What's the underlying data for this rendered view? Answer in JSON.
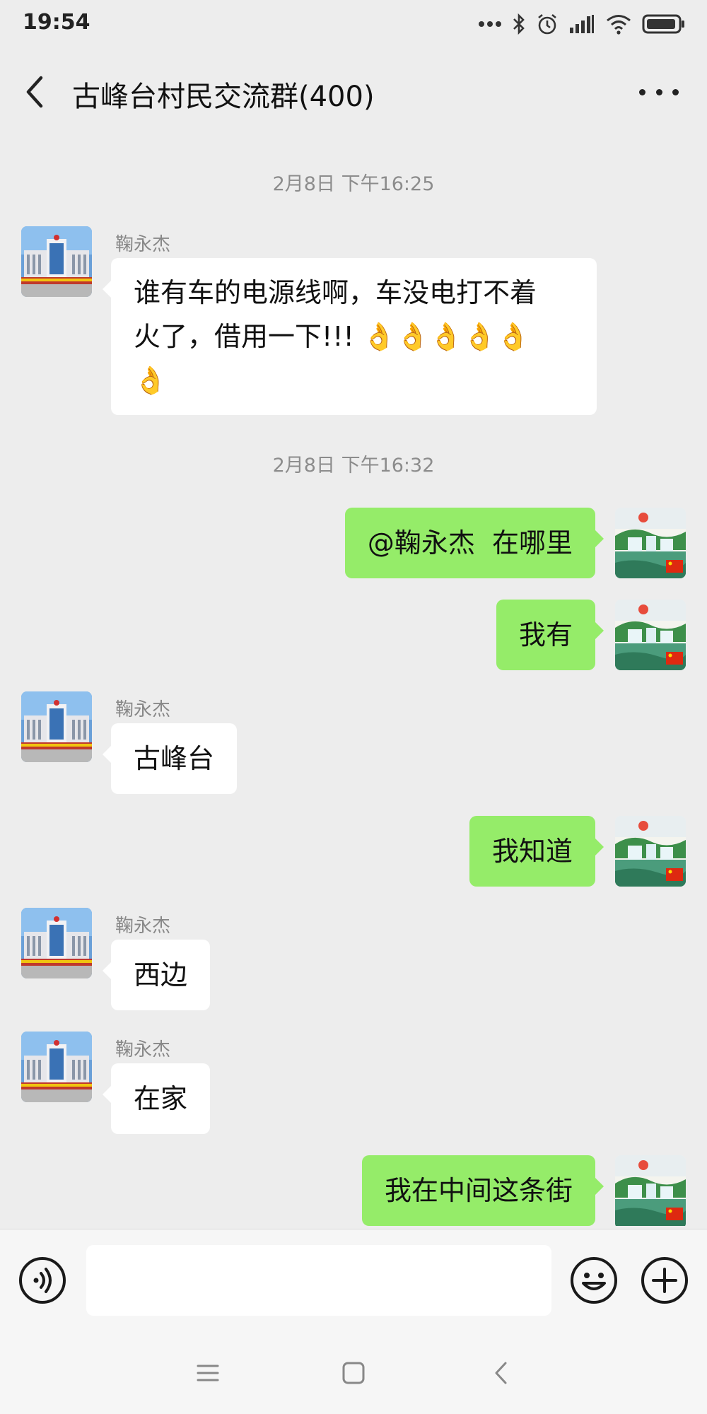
{
  "status": {
    "time": "19:54"
  },
  "header": {
    "title": "古峰台村民交流群(400)"
  },
  "messages": [
    {
      "kind": "time",
      "text": "2月8日 下午16:25"
    },
    {
      "kind": "in",
      "sender": "鞠永杰",
      "line1": "谁有车的电源线啊，车没电打不着",
      "line2": "火了，借用一下!!! ",
      "emoji": "👌👌👌👌👌",
      "line3_emoji": "👌"
    },
    {
      "kind": "time",
      "text": "2月8日 下午16:32"
    },
    {
      "kind": "out",
      "text": "@鞠永杰  在哪里"
    },
    {
      "kind": "out",
      "text": "我有"
    },
    {
      "kind": "in",
      "sender": "鞠永杰",
      "text": "古峰台"
    },
    {
      "kind": "out",
      "text": "我知道"
    },
    {
      "kind": "in",
      "sender": "鞠永杰",
      "text": "西边"
    },
    {
      "kind": "in",
      "sender": "鞠永杰",
      "text": "在家"
    },
    {
      "kind": "out",
      "text": "我在中间这条街"
    }
  ],
  "input": {
    "value": "",
    "placeholder": ""
  },
  "icons": {
    "back": "back-arrow-icon",
    "more": "more-dots-icon",
    "voice": "voice-icon",
    "emoji": "emoji-icon",
    "plus": "plus-icon",
    "menu": "menu-icon",
    "home": "home-icon",
    "nav_back": "nav-back-icon"
  },
  "colors": {
    "background": "#ededed",
    "incoming_bubble": "#ffffff",
    "outgoing_bubble": "#95ec69",
    "timestamp": "#8c8c8c"
  }
}
